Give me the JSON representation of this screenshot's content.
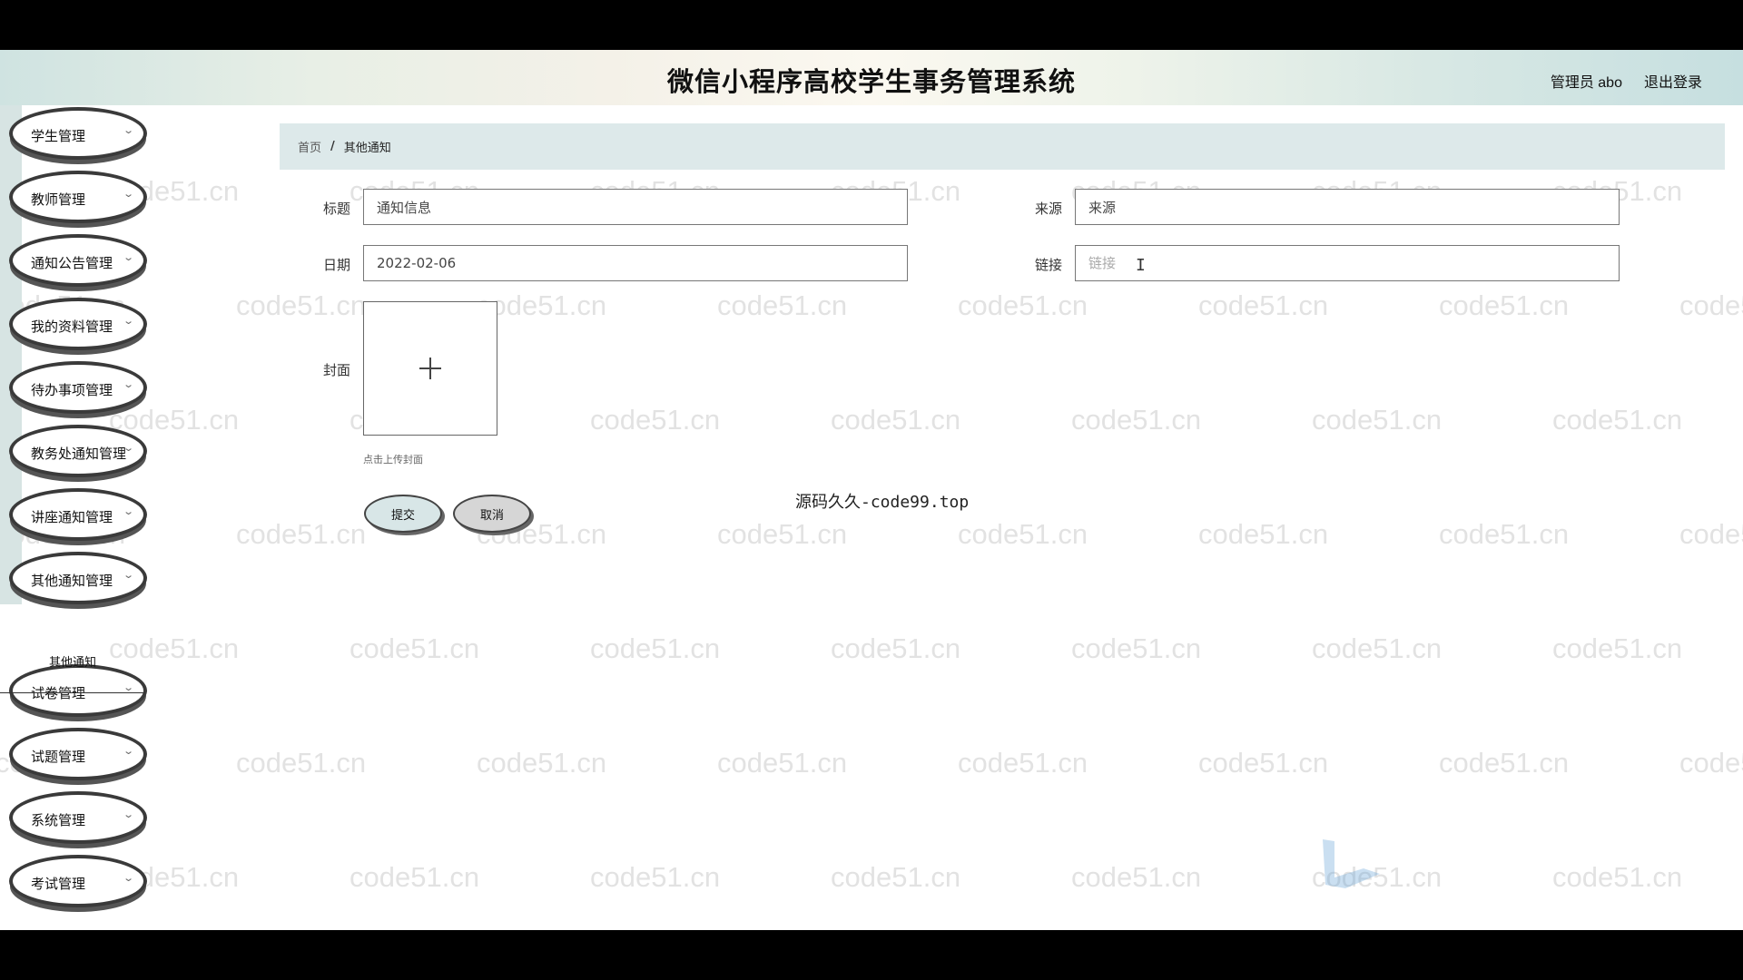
{
  "header": {
    "title": "微信小程序高校学生事务管理系统",
    "user_label": "管理员 abo",
    "logout_label": "退出登录"
  },
  "sidebar": {
    "items": [
      {
        "label": "学生管理"
      },
      {
        "label": "教师管理"
      },
      {
        "label": "通知公告管理"
      },
      {
        "label": "我的资料管理"
      },
      {
        "label": "待办事项管理"
      },
      {
        "label": "教务处通知管理"
      },
      {
        "label": "讲座通知管理"
      },
      {
        "label": "其他通知管理"
      },
      {
        "label": "试卷管理"
      },
      {
        "label": "试题管理"
      },
      {
        "label": "系统管理"
      },
      {
        "label": "考试管理"
      }
    ],
    "submenu_label": "其他通知"
  },
  "breadcrumb": {
    "home": "首页",
    "separator": "/",
    "current": "其他通知"
  },
  "form": {
    "title_label": "标题",
    "title_value": "通知信息",
    "source_label": "来源",
    "source_value": "来源",
    "date_label": "日期",
    "date_value": "2022-02-06",
    "link_label": "链接",
    "link_placeholder": "链接",
    "cover_label": "封面",
    "cover_hint": "点击上传封面",
    "submit_label": "提交",
    "cancel_label": "取消"
  },
  "watermark_text": "code51.cn",
  "center_watermark": "源码久久-code99.top",
  "colors": {
    "header_bg": "#e6efe9",
    "breadcrumb_bg": "#dde9ea",
    "submit_bg": "#d8e6e7",
    "cancel_bg": "#d6d6d6"
  }
}
